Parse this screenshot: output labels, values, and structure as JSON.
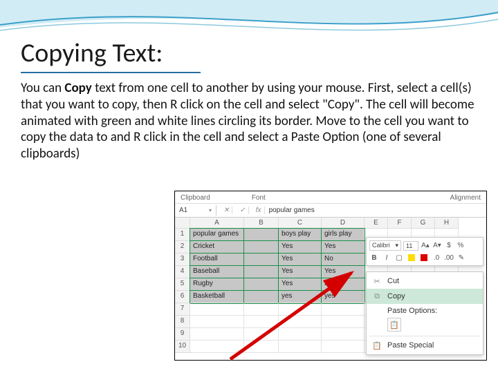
{
  "title": "Copying Text:",
  "body": {
    "pre": "You can ",
    "bold": "Copy",
    "post": " text from one cell to another by using your mouse. First, select a cell(s) that you want to copy, then R click on the cell and select \"Copy\". The cell will become animated with green and white lines circling its border. Move to the cell you want to copy the data to and R click in the cell and select a Paste Option (one of several clipboards)"
  },
  "excel": {
    "ribbon": {
      "group1": "Clipboard",
      "group2": "Font",
      "group3": "Alignment"
    },
    "namebox": "A1",
    "fx": "fx",
    "fx_value": "popular games",
    "cols": [
      "A",
      "B",
      "C",
      "D",
      "E",
      "F",
      "G",
      "H"
    ],
    "rows": [
      {
        "n": "1",
        "a": "popular games",
        "b": "",
        "c": "boys play",
        "d": "girls play"
      },
      {
        "n": "2",
        "a": "Cricket",
        "b": "",
        "c": "Yes",
        "d": "Yes"
      },
      {
        "n": "3",
        "a": "Football",
        "b": "",
        "c": "Yes",
        "d": "No"
      },
      {
        "n": "4",
        "a": "Baseball",
        "b": "",
        "c": "Yes",
        "d": "Yes"
      },
      {
        "n": "5",
        "a": "Rugby",
        "b": "",
        "c": "Yes",
        "d": "No"
      },
      {
        "n": "6",
        "a": "Basketball",
        "b": "",
        "c": "yes",
        "d": "yes"
      },
      {
        "n": "7",
        "a": "",
        "b": "",
        "c": "",
        "d": ""
      },
      {
        "n": "8",
        "a": "",
        "b": "",
        "c": "",
        "d": ""
      },
      {
        "n": "9",
        "a": "",
        "b": "",
        "c": "",
        "d": ""
      },
      {
        "n": "10",
        "a": "",
        "b": "",
        "c": "",
        "d": ""
      }
    ],
    "minibar": {
      "font": "Calibri",
      "size": "11",
      "increase": "A",
      "decrease": "A"
    },
    "menu": {
      "cut": "Cut",
      "copy": "Copy",
      "paste_label": "Paste Options:",
      "paste_special": "Paste Special"
    }
  }
}
